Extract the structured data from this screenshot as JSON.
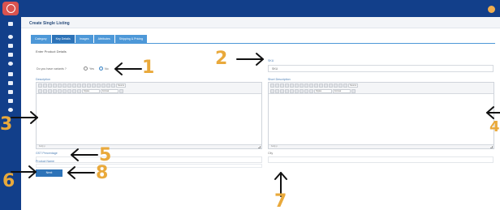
{
  "header": {
    "page_title": "Create Single Listing"
  },
  "tabs": [
    {
      "label": "Category"
    },
    {
      "label": "Key Details"
    },
    {
      "label": "Images"
    },
    {
      "label": "Attributes"
    },
    {
      "label": "Shipping & Pricing"
    }
  ],
  "active_tab": "Key Details",
  "form": {
    "section_title": "Enter Product Details",
    "variants_question": "Do you have variants ?",
    "variant_options": [
      "Yes",
      "No"
    ],
    "variant_selected": "No",
    "sku_label": "SKU",
    "sku_placeholder": "SKU",
    "description_label": "Description",
    "short_description_label": "Short Description",
    "gst_label": "GST Percentage",
    "city_label": "City",
    "city_value": "",
    "product_name_label": "Product Name",
    "next_label": "Next"
  },
  "editor": {
    "styles_option": "Styles",
    "format_option": "Format",
    "source_label": "Source",
    "status_text": "body p"
  },
  "annotations": [
    "1",
    "2",
    "3",
    "4",
    "5",
    "6",
    "7",
    "8"
  ],
  "colors": {
    "topbar": "#123f8a",
    "tab": "#4d98d8",
    "tab_active": "#2d73b8",
    "annotation": "#e9a93b",
    "logo": "#d9534f"
  }
}
